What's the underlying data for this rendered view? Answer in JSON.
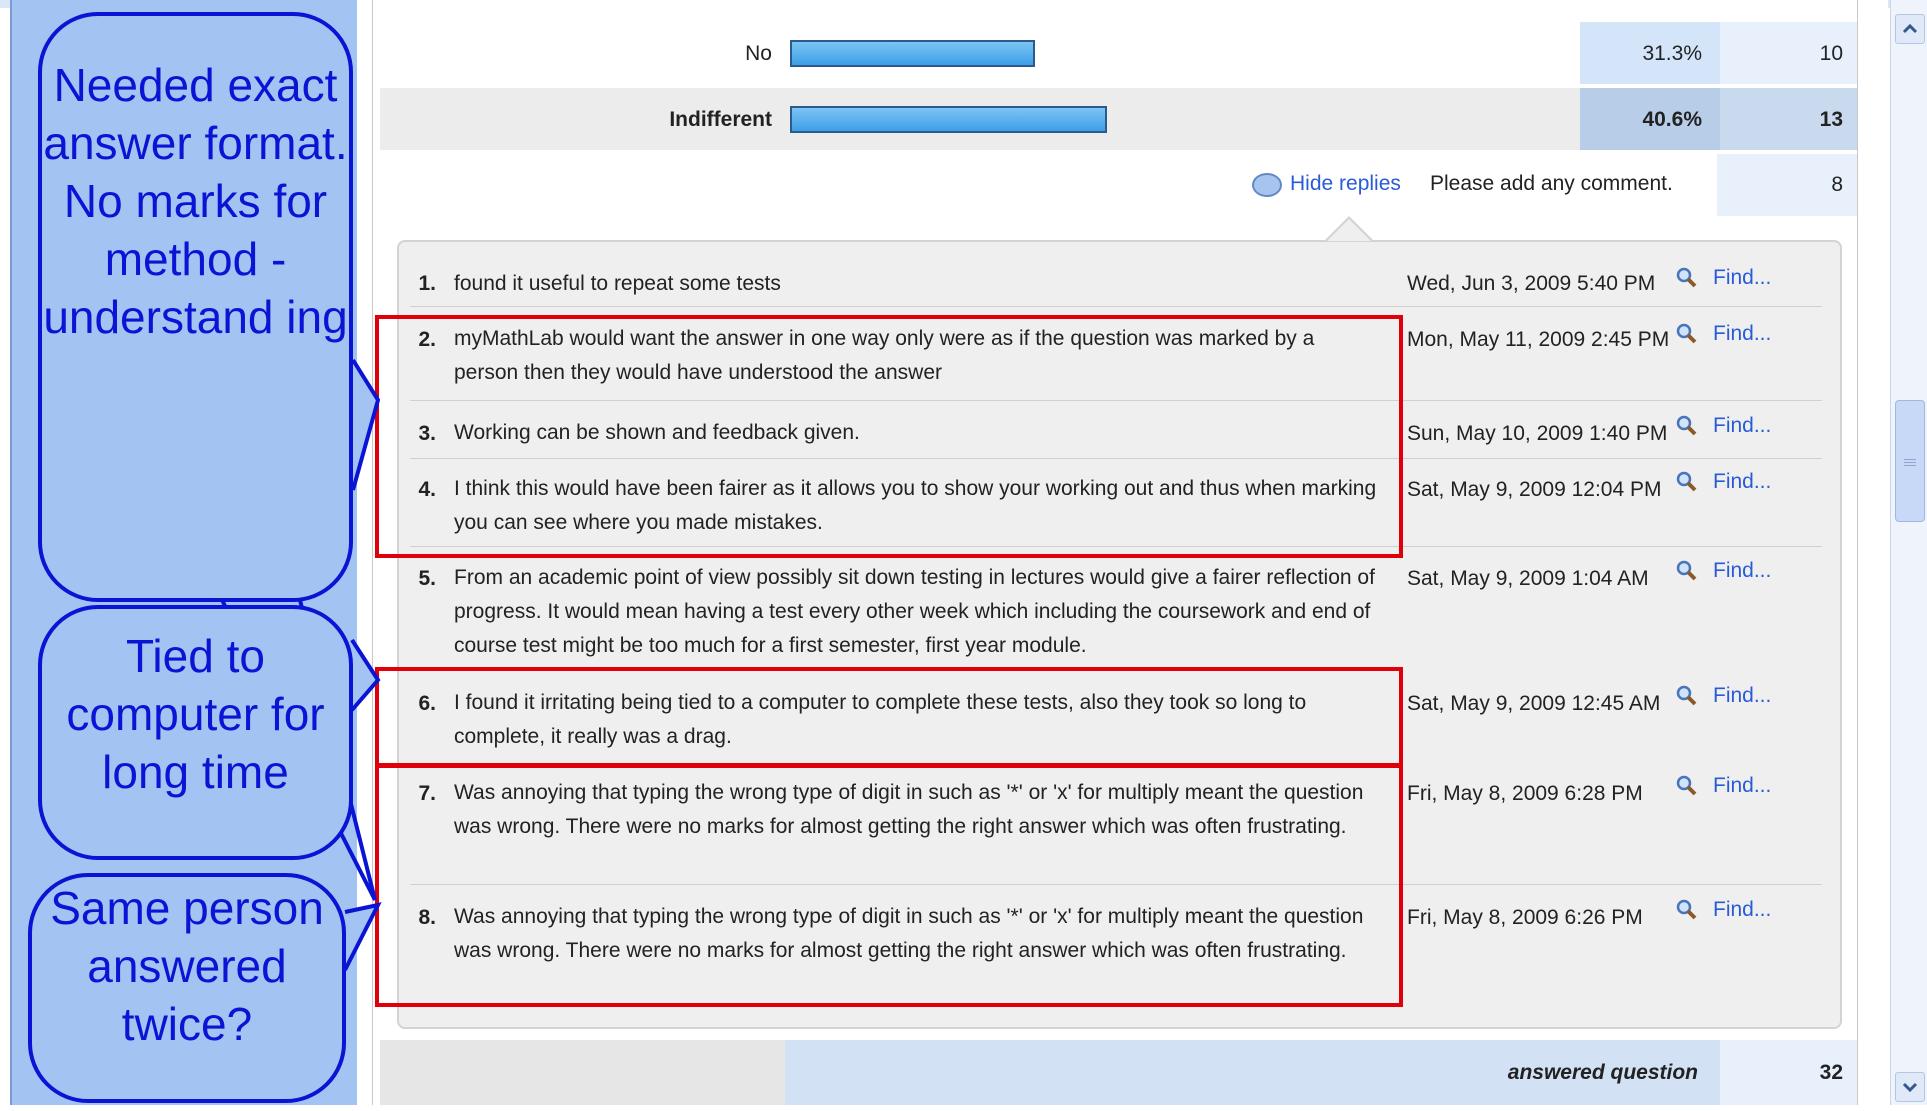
{
  "poll_rows": [
    {
      "label": "No",
      "percent": "31.3%",
      "count": "10",
      "bar_fraction": 0.313,
      "bold": false
    },
    {
      "label": "Indifferent",
      "percent": "40.6%",
      "count": "13",
      "bar_fraction": 0.406,
      "bold": true
    }
  ],
  "comments_header": {
    "link_label": "Hide replies",
    "prompt": "Please add any comment.",
    "count": "8"
  },
  "replies": [
    {
      "num": "1.",
      "text": "found it useful to repeat some tests",
      "date": "Wed, Jun 3, 2009 5:40 PM",
      "action": "Find..."
    },
    {
      "num": "2.",
      "text": "myMathLab would want the answer in one way only were as if the question was marked by a person then they would have understood the answer",
      "date": "Mon, May 11, 2009 2:45 PM",
      "action": "Find..."
    },
    {
      "num": "3.",
      "text": "Working can be shown and feedback given.",
      "date": "Sun, May 10, 2009 1:40 PM",
      "action": "Find..."
    },
    {
      "num": "4.",
      "text": "I think this would have been fairer as it allows you to show your working out and thus when marking you can see where you made mistakes.",
      "date": "Sat, May 9, 2009 12:04 PM",
      "action": "Find..."
    },
    {
      "num": "5.",
      "text": "From an academic point of view possibly sit down testing in lectures would give a fairer reflection of progress. It would mean having a test every other week which including the coursework and end of course test might be too much for a first semester, first year module.",
      "date": "Sat, May 9, 2009 1:04 AM",
      "action": "Find..."
    },
    {
      "num": "6.",
      "text": "I found it irritating being tied to a computer to complete these tests, also they took so long to complete, it really was a drag.",
      "date": "Sat, May 9, 2009 12:45 AM",
      "action": "Find..."
    },
    {
      "num": "7.",
      "text": "Was annoying that typing the wrong type of digit in such as '*' or 'x' for multiply meant the question was wrong. There were no marks for almost getting the right answer which was often frustrating.",
      "date": "Fri, May 8, 2009 6:28 PM",
      "action": "Find..."
    },
    {
      "num": "8.",
      "text": "Was annoying that typing the wrong type of digit in such as '*' or 'x' for multiply meant the question was wrong. There were no marks for almost getting the right answer which was often frustrating.",
      "date": "Fri, May 8, 2009 6:26 PM",
      "action": "Find..."
    }
  ],
  "footer": {
    "label": "answered question",
    "count": "32"
  },
  "callouts": [
    "Needed exact answer format. No marks for method - understand ing",
    "Tied to computer for long time",
    "Same person answered twice?"
  ],
  "scrollbar": {
    "up_icon": "chevron-up-icon",
    "down_icon": "chevron-down-icon"
  },
  "colors": {
    "callout_fill": "#a3c4f2",
    "callout_stroke": "#0a14d4",
    "highlight_box": "#e0000a",
    "link": "#2a5bd7"
  }
}
